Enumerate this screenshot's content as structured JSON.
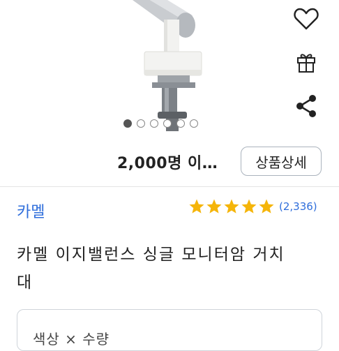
{
  "product": {
    "stats_text": "2,000명 이…",
    "detail_button_label": "상품상세",
    "brand": "카멜",
    "rating": 5,
    "review_count": "(2,336)",
    "title": "카멜 이지밸런스 싱글 모니터암 거치대",
    "options_label": "색상 × 수량"
  },
  "carousel": {
    "total": 6,
    "active": 0
  },
  "icons": [
    "heart-icon",
    "gift-icon",
    "share-icon"
  ],
  "colors": {
    "brand": "#2f6edb",
    "star": "#f5b50a",
    "border": "#cfd4da"
  }
}
